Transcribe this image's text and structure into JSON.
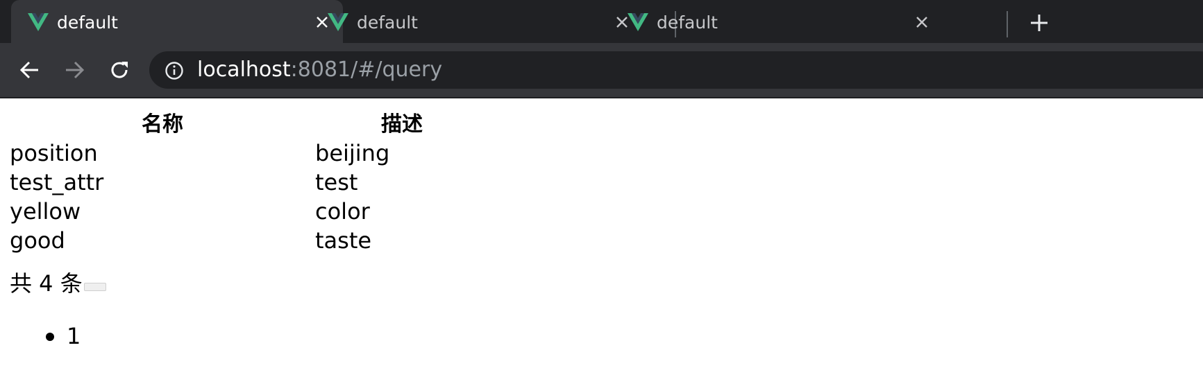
{
  "tabs": [
    {
      "title": "default",
      "active": true,
      "icon": "vue-logo-icon",
      "close": "close-icon"
    },
    {
      "title": "default",
      "active": false,
      "icon": "vue-logo-icon",
      "close": "close-icon"
    },
    {
      "title": "default",
      "active": false,
      "icon": "vue-logo-icon",
      "close": "close-icon"
    }
  ],
  "new_tab_icon": "plus-icon",
  "toolbar": {
    "back_icon": "arrow-left-icon",
    "forward_icon": "arrow-right-icon",
    "reload_icon": "reload-icon",
    "info_icon": "info-icon",
    "url_host": "localhost",
    "url_rest": ":8081/#/query"
  },
  "table": {
    "headers": [
      "名称",
      "描述"
    ],
    "rows": [
      [
        "position",
        "beijing"
      ],
      [
        "test_attr",
        "test"
      ],
      [
        "yellow",
        "color"
      ],
      [
        "good",
        "taste"
      ]
    ]
  },
  "pagination": {
    "total_text": "共 4 条",
    "pages": [
      "1"
    ]
  },
  "colors": {
    "tabstrip_bg": "#202124",
    "active_tab_bg": "#35363a",
    "omnibox_bg": "#202124",
    "vue_green": "#42b883",
    "vue_dark": "#35495e"
  }
}
